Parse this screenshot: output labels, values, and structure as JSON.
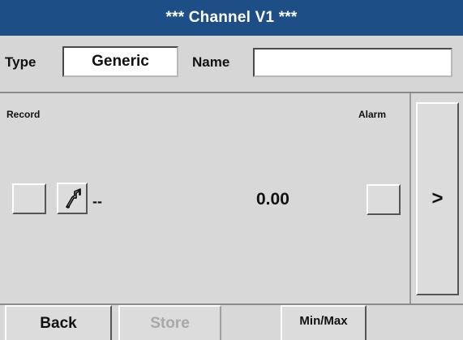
{
  "header": {
    "title": "*** Channel V1 ***"
  },
  "top_row": {
    "type_label": "Type",
    "type_value": "Generic",
    "name_label": "Name",
    "name_value": ""
  },
  "main": {
    "record_label": "Record",
    "alarm_label": "Alarm",
    "unit_placeholder": "--",
    "value": "0.00",
    "record_checkbox_icon": "blank-checkbox-icon",
    "settings_icon": "wrench-icon",
    "alarm_checkbox_icon": "blank-checkbox-icon"
  },
  "side": {
    "next_label": ">"
  },
  "footer": {
    "back_label": "Back",
    "store_label": "Store",
    "minmax_label": "Min/Max"
  },
  "colors": {
    "title_bar": "#1d4e86",
    "background": "#d8d8d8",
    "disabled_text": "#a8a8a8"
  }
}
